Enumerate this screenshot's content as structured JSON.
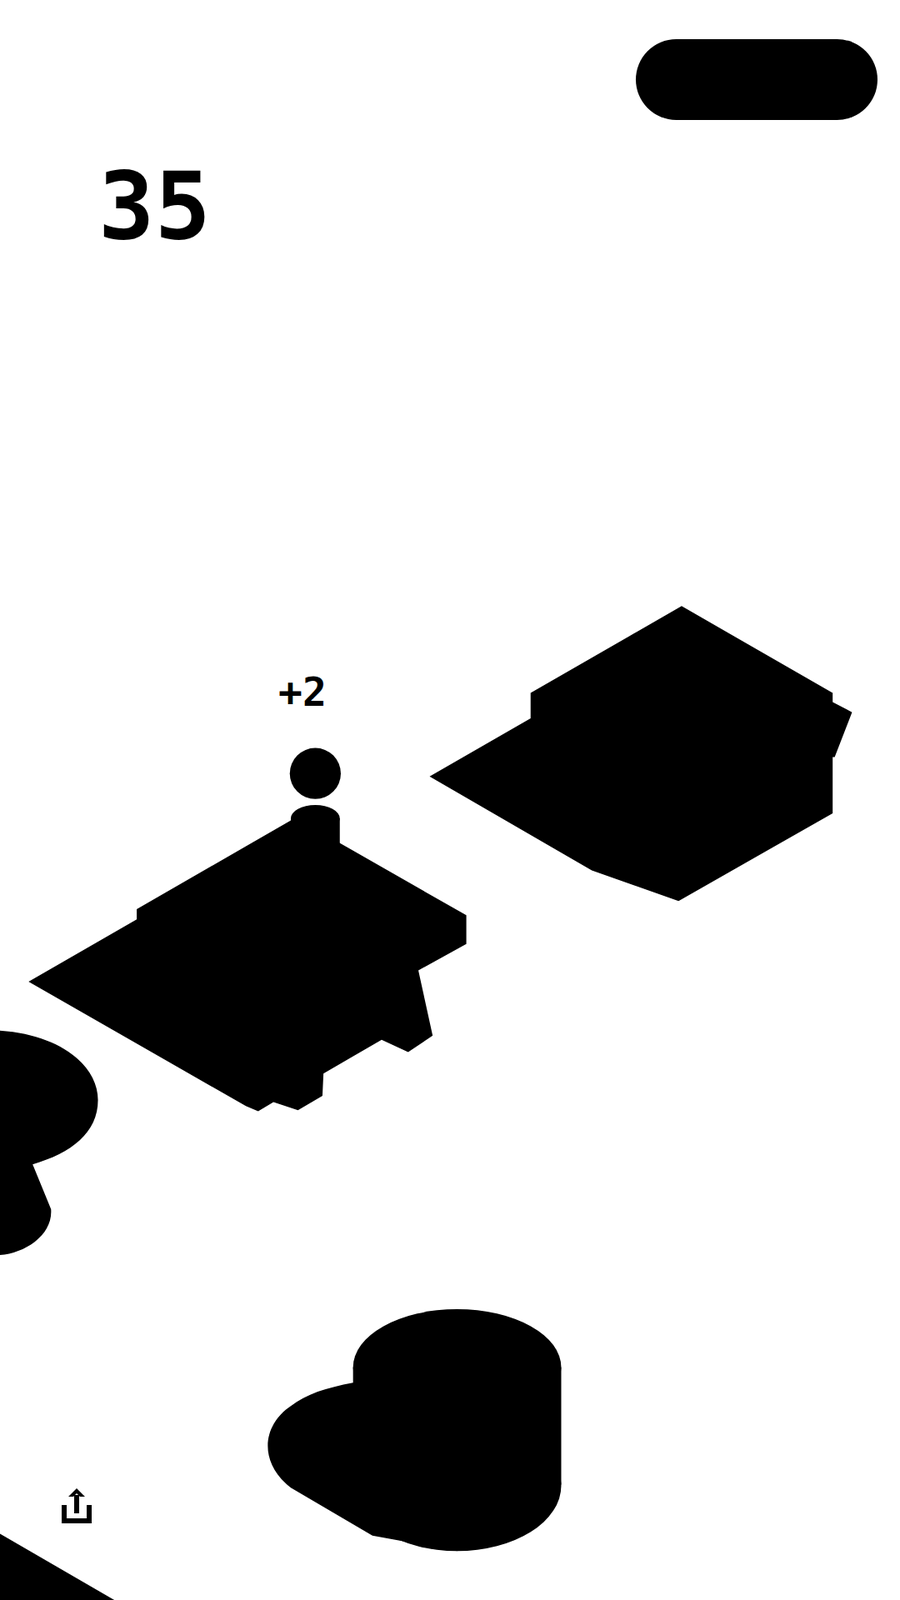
{
  "hud": {
    "score": "35"
  },
  "bonus": {
    "text": "+2"
  }
}
